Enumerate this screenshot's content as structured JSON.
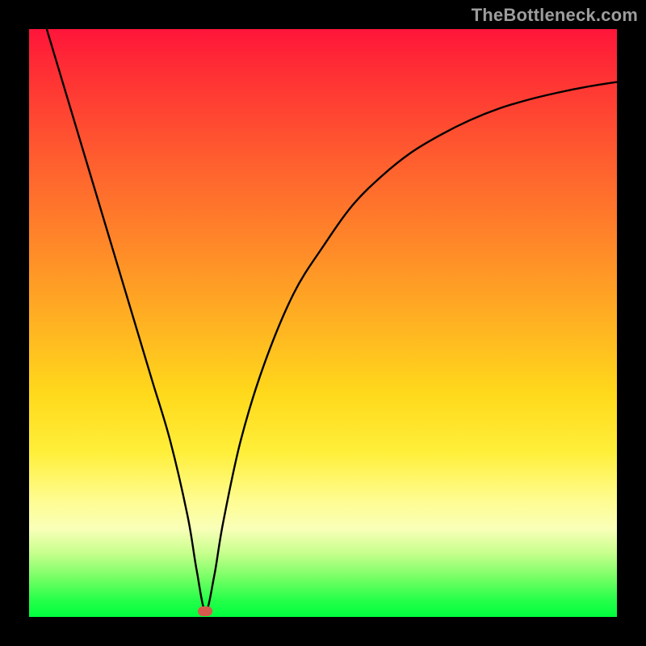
{
  "watermark": "TheBottleneck.com",
  "colors": {
    "frame": "#000000",
    "curve_stroke": "#000000",
    "marker_fill": "#d85a4d",
    "watermark_text": "#9d9d9d"
  },
  "chart_data": {
    "type": "line",
    "title": "",
    "xlabel": "",
    "ylabel": "",
    "xlim": [
      0,
      100
    ],
    "ylim": [
      0,
      100
    ],
    "grid": false,
    "series": [
      {
        "name": "bottleneck-curve",
        "x": [
          3,
          6,
          9,
          12,
          15,
          18,
          21,
          24,
          27,
          28.5,
          30,
          31.5,
          33,
          36,
          40,
          45,
          50,
          55,
          60,
          65,
          70,
          75,
          80,
          85,
          90,
          95,
          100
        ],
        "y": [
          100,
          90,
          80,
          70,
          60,
          50,
          40,
          30,
          17,
          8,
          1,
          7,
          16,
          30,
          43,
          55,
          63,
          70,
          75,
          79,
          82,
          84.5,
          86.5,
          88,
          89.2,
          90.2,
          91
        ]
      }
    ],
    "marker": {
      "x": 30,
      "y": 1,
      "shape": "rounded-rect"
    },
    "background_gradient": {
      "direction": "top-to-bottom",
      "stops": [
        {
          "pos": 0,
          "color": "#ff153a"
        },
        {
          "pos": 50,
          "color": "#ffbf20"
        },
        {
          "pos": 80,
          "color": "#fffc8f"
        },
        {
          "pos": 100,
          "color": "#00ff3e"
        }
      ]
    }
  }
}
